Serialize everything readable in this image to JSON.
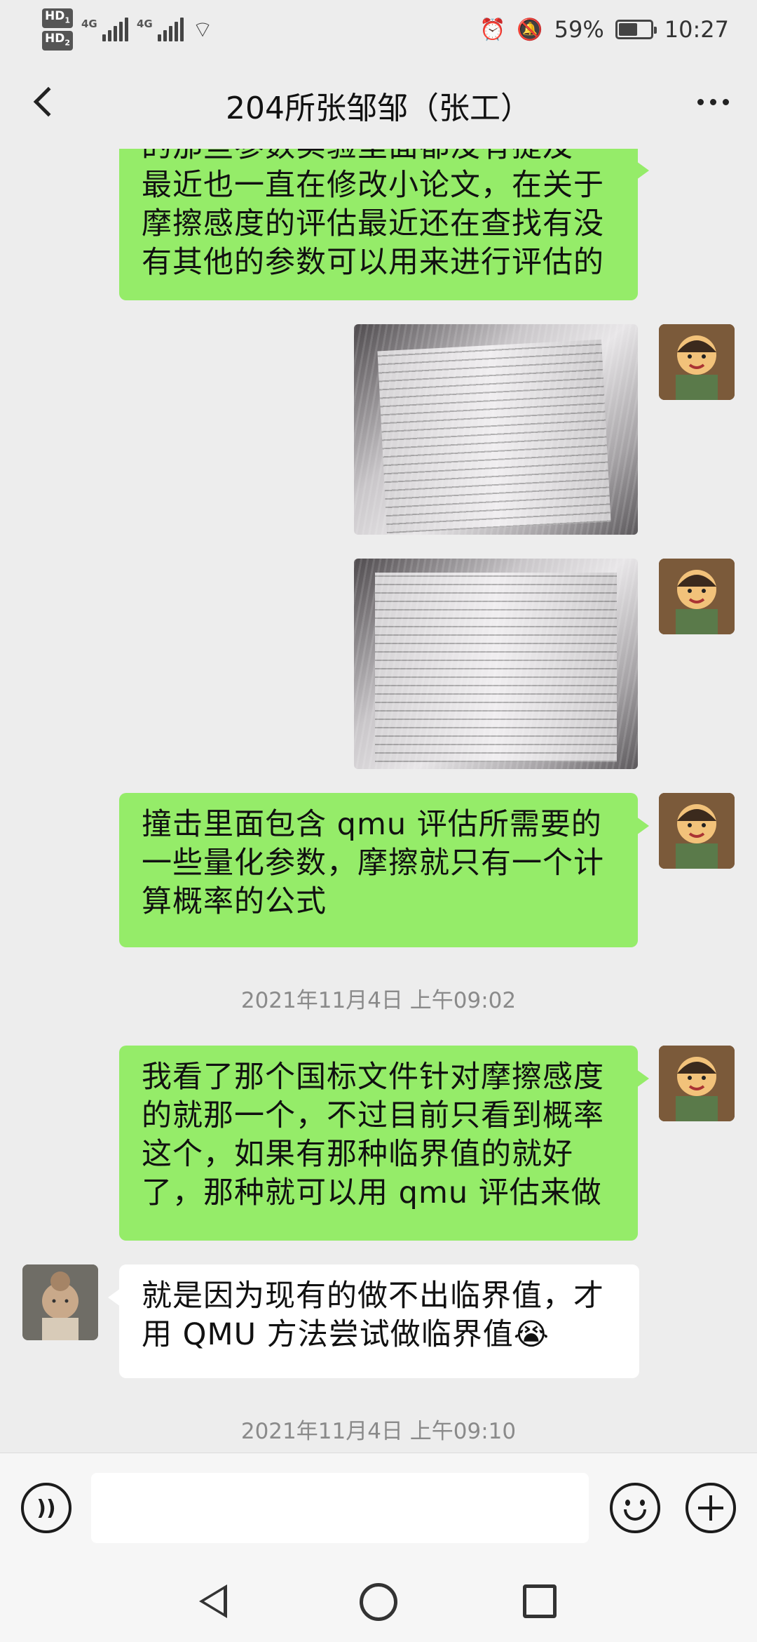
{
  "status_bar": {
    "network_badges": [
      "HD",
      "HD"
    ],
    "network_badge_sub": [
      "1",
      "2"
    ],
    "network_type": [
      "4G",
      "4G"
    ],
    "battery_percent": "59%",
    "battery_level": 0.59,
    "time": "10:27",
    "icons": [
      "alarm-icon",
      "mute-icon",
      "wifi-icon"
    ]
  },
  "header": {
    "back_icon": "chevron-left-icon",
    "title": "204所张邹邹（张工）",
    "more_icon": "more-dots-icon"
  },
  "messages": [
    {
      "type": "text",
      "from": "me",
      "text": "的那些参数实验里面都没有提及\n最近也一直在修改小论文，在关于\n摩擦感度的评估最近还在查找有没\n有其他的参数可以用来进行评估的"
    },
    {
      "type": "image",
      "from": "me",
      "description": "photo-of-document"
    },
    {
      "type": "image",
      "from": "me",
      "description": "photo-of-document"
    },
    {
      "type": "text",
      "from": "me",
      "text": "撞击里面包含 qmu 评估所需要的\n一些量化参数，摩擦就只有一个计\n算概率的公式"
    },
    {
      "type": "time",
      "text": "2021年11月4日 上午09:02"
    },
    {
      "type": "text",
      "from": "me",
      "text": "我看了那个国标文件针对摩擦感度\n的就那一个，不过目前只看到概率\n这个，如果有那种临界值的就好\n了，那种就可以用 qmu 评估来做"
    },
    {
      "type": "text",
      "from": "them",
      "text": "就是因为现有的做不出临界值，才\n用 QMU 方法尝试做临界值😭"
    },
    {
      "type": "time",
      "text": "2021年11月4日 上午09:10"
    }
  ],
  "input_bar": {
    "voice_icon": "voice-icon",
    "input_value": "",
    "emoji_icon": "emoji-icon",
    "plus_icon": "plus-icon"
  },
  "colors": {
    "outgoing_bubble": "#95ec69",
    "incoming_bubble": "#ffffff",
    "background": "#ededed"
  }
}
